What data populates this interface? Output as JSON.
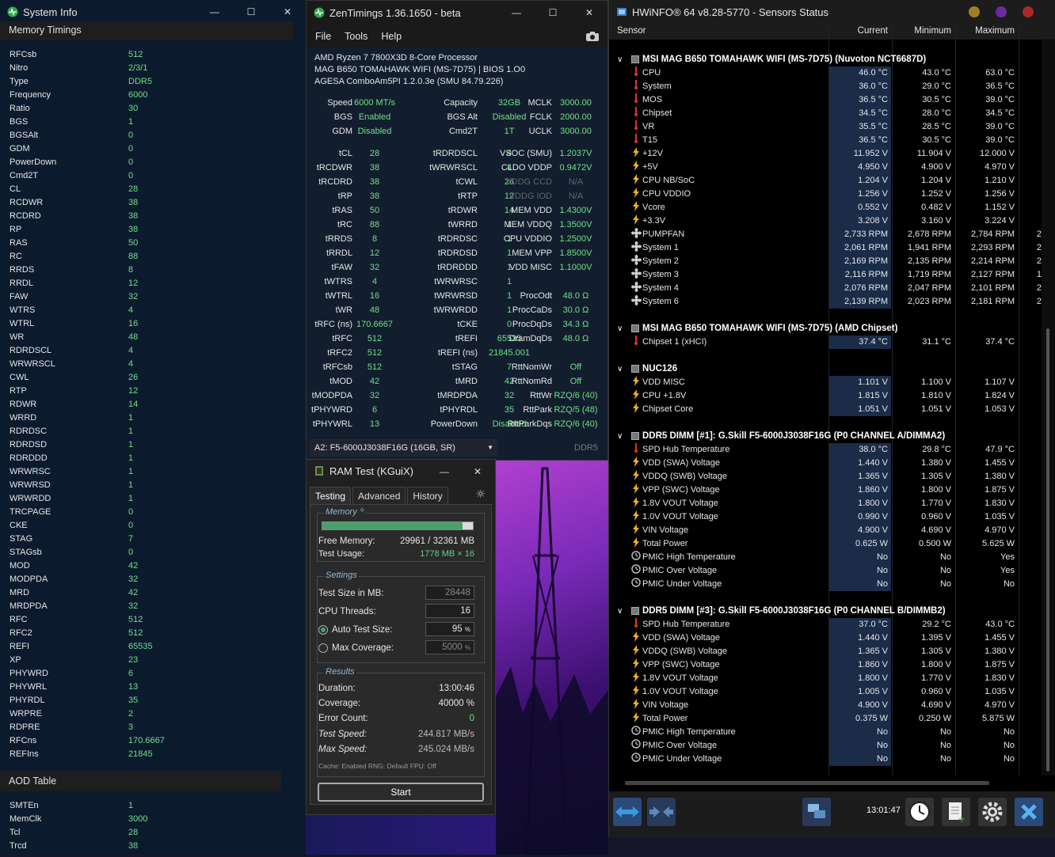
{
  "sysinfo": {
    "title": "System Info",
    "section1": "Memory Timings",
    "rows": [
      [
        "RFCsb",
        "512"
      ],
      [
        "Nitro",
        "2/3/1"
      ],
      [
        "Type",
        "DDR5"
      ],
      [
        "Frequency",
        "6000"
      ],
      [
        "Ratio",
        "30"
      ],
      [
        "BGS",
        "1"
      ],
      [
        "BGSAlt",
        "0"
      ],
      [
        "GDM",
        "0"
      ],
      [
        "PowerDown",
        "0"
      ],
      [
        "Cmd2T",
        "0"
      ],
      [
        "CL",
        "28"
      ],
      [
        "RCDWR",
        "38"
      ],
      [
        "RCDRD",
        "38"
      ],
      [
        "RP",
        "38"
      ],
      [
        "RAS",
        "50"
      ],
      [
        "RC",
        "88"
      ],
      [
        "RRDS",
        "8"
      ],
      [
        "RRDL",
        "12"
      ],
      [
        "FAW",
        "32"
      ],
      [
        "WTRS",
        "4"
      ],
      [
        "WTRL",
        "16"
      ],
      [
        "WR",
        "48"
      ],
      [
        "RDRDSCL",
        "4"
      ],
      [
        "WRWRSCL",
        "4"
      ],
      [
        "CWL",
        "26"
      ],
      [
        "RTP",
        "12"
      ],
      [
        "RDWR",
        "14"
      ],
      [
        "WRRD",
        "1"
      ],
      [
        "RDRDSC",
        "1"
      ],
      [
        "RDRDSD",
        "1"
      ],
      [
        "RDRDDD",
        "1"
      ],
      [
        "WRWRSC",
        "1"
      ],
      [
        "WRWRSD",
        "1"
      ],
      [
        "WRWRDD",
        "1"
      ],
      [
        "TRCPAGE",
        "0"
      ],
      [
        "CKE",
        "0"
      ],
      [
        "STAG",
        "7"
      ],
      [
        "STAGsb",
        "0"
      ],
      [
        "MOD",
        "42"
      ],
      [
        "MODPDA",
        "32"
      ],
      [
        "MRD",
        "42"
      ],
      [
        "MRDPDA",
        "32"
      ],
      [
        "RFC",
        "512"
      ],
      [
        "RFC2",
        "512"
      ],
      [
        "REFI",
        "65535"
      ],
      [
        "XP",
        "23"
      ],
      [
        "PHYWRD",
        "6"
      ],
      [
        "PHYWRL",
        "13"
      ],
      [
        "PHYRDL",
        "35"
      ],
      [
        "WRPRE",
        "2"
      ],
      [
        "RDPRE",
        "3"
      ],
      [
        "RFCns",
        "170.6667"
      ],
      [
        "REFIns",
        "21845"
      ]
    ],
    "section2": "AOD Table",
    "rows2": [
      [
        "SMTEn",
        "1"
      ],
      [
        "MemClk",
        "3000"
      ],
      [
        "Tcl",
        "28"
      ],
      [
        "Trcd",
        "38"
      ]
    ]
  },
  "zen": {
    "title": "ZenTimings 1.36.1650 - beta",
    "menu": [
      "File",
      "Tools",
      "Help"
    ],
    "info": [
      "AMD Ryzen 7 7800X3D 8-Core Processor",
      "MAG B650 TOMAHAWK WIFI (MS-7D75) | BIOS 1.O0",
      "AGESA ComboAm5PI 1.2.0.3e (SMU 84.79.226)"
    ],
    "top": [
      [
        "Speed",
        "6000 MT/s",
        "Capacity",
        "32GB",
        "MCLK",
        "3000.00"
      ],
      [
        "BGS",
        "Enabled",
        "BGS Alt",
        "Disabled",
        "FCLK",
        "2000.00"
      ],
      [
        "GDM",
        "Disabled",
        "Cmd2T",
        "1T",
        "UCLK",
        "3000.00"
      ]
    ],
    "timings": [
      [
        "tCL",
        "28",
        "tRDRDSCL",
        "4",
        "VSOC (SMU)",
        "1.2037V"
      ],
      [
        "tRCDWR",
        "38",
        "tWRWRSCL",
        "4",
        "CLDO VDDP",
        "0.9472V"
      ],
      [
        "tRCDRD",
        "38",
        "tCWL",
        "26",
        "VDDG CCD",
        "N/A"
      ],
      [
        "tRP",
        "38",
        "tRTP",
        "12",
        "VDDG IOD",
        "N/A"
      ],
      [
        "tRAS",
        "50",
        "tRDWR",
        "14",
        "MEM VDD",
        "1.4300V"
      ],
      [
        "tRC",
        "88",
        "tWRRD",
        "1",
        "MEM VDDQ",
        "1.3500V"
      ],
      [
        "tRRDS",
        "8",
        "tRDRDSC",
        "1",
        "CPU VDDIO",
        "1.2500V"
      ],
      [
        "tRRDL",
        "12",
        "tRDRDSD",
        "1",
        "MEM VPP",
        "1.8500V"
      ],
      [
        "tFAW",
        "32",
        "tRDRDDD",
        "1",
        "VDD MISC",
        "1.1000V"
      ],
      [
        "tWTRS",
        "4",
        "tWRWRSC",
        "1",
        "",
        ""
      ],
      [
        "tWTRL",
        "16",
        "tWRWRSD",
        "1",
        "ProcOdt",
        "48.0 Ω"
      ],
      [
        "tWR",
        "48",
        "tWRWRDD",
        "1",
        "ProcCaDs",
        "30.0 Ω"
      ],
      [
        "tRFC (ns)",
        "170.6667",
        "tCKE",
        "0",
        "ProcDqDs",
        "34.3 Ω"
      ],
      [
        "tRFC",
        "512",
        "tREFI",
        "65535",
        "DramDqDs",
        "48.0 Ω"
      ],
      [
        "tRFC2",
        "512",
        "tREFI (ns)",
        "21845.001",
        "",
        ""
      ],
      [
        "tRFCsb",
        "512",
        "tSTAG",
        "7",
        "RttNomWr",
        "Off"
      ],
      [
        "tMOD",
        "42",
        "tMRD",
        "42",
        "RttNomRd",
        "Off"
      ],
      [
        "tMODPDA",
        "32",
        "tMRDPDA",
        "32",
        "RttWr",
        "RZQ/6 (40)"
      ],
      [
        "tPHYWRD",
        "6",
        "tPHYRDL",
        "35",
        "RttPark",
        "RZQ/5 (48)"
      ],
      [
        "tPHYWRL",
        "13",
        "PowerDown",
        "Disabled",
        "RttParkDqs",
        "RZQ/6 (40)"
      ]
    ],
    "module": "A2: F5-6000J3038F16G (16GB, SR)",
    "memtype": "DDR5"
  },
  "ram": {
    "title": "RAM Test (KGuiX)",
    "tabs": [
      "Testing",
      "Advanced",
      "History"
    ],
    "memory_label": "Memory",
    "memory_used_fraction": 0.93,
    "free_memory_label": "Free Memory:",
    "free_memory": "29961 / 32361 MB",
    "test_usage_label": "Test Usage:",
    "test_usage": "1778 MB × 16",
    "settings_label": "Settings",
    "test_size_label": "Test Size in MB:",
    "test_size": "28448",
    "cpu_threads_label": "CPU Threads:",
    "cpu_threads": "16",
    "auto_label": "Auto Test Size:",
    "auto_value": "95",
    "max_label": "Max Coverage:",
    "max_value": "5000",
    "pct": "%",
    "results_label": "Results",
    "duration_label": "Duration:",
    "duration": "13:00:46",
    "coverage_label": "Coverage:",
    "coverage": "40000 %",
    "errors_label": "Error Count:",
    "errors": "0",
    "speed_label": "Test Speed:",
    "speed": "244.817 MB/s",
    "maxspeed_label": "Max Speed:",
    "maxspeed": "245.024 MB/s",
    "footer": "Cache: Enabled  RNG: Default  FPU: Off",
    "start": "Start"
  },
  "hw": {
    "title": "HWiNFO® 64 v8.28-5770 - Sensors Status",
    "cols": [
      "Sensor",
      "Current",
      "Minimum",
      "Maximum"
    ],
    "groups": [
      {
        "name": "MSI MAG B650 TOMAHAWK WIFI (MS-7D75) (Nuvoton NCT6687D)",
        "rows": [
          [
            "t",
            "CPU",
            "46.0 °C",
            "43.0 °C",
            "63.0 °C",
            ""
          ],
          [
            "t",
            "System",
            "36.0 °C",
            "29.0 °C",
            "36.5 °C",
            ""
          ],
          [
            "t",
            "MOS",
            "36.5 °C",
            "30.5 °C",
            "39.0 °C",
            ""
          ],
          [
            "t",
            "Chipset",
            "34.5 °C",
            "28.0 °C",
            "34.5 °C",
            ""
          ],
          [
            "t",
            "VR",
            "35.5 °C",
            "28.5 °C",
            "39.0 °C",
            ""
          ],
          [
            "t",
            "T15",
            "36.5 °C",
            "30.5 °C",
            "39.0 °C",
            ""
          ],
          [
            "v",
            "+12V",
            "11.952 V",
            "11.904 V",
            "12.000 V",
            ""
          ],
          [
            "v",
            "+5V",
            "4.950 V",
            "4.900 V",
            "4.970 V",
            ""
          ],
          [
            "v",
            "CPU NB/SoC",
            "1.204 V",
            "1.204 V",
            "1.210 V",
            ""
          ],
          [
            "v",
            "CPU VDDIO",
            "1.256 V",
            "1.252 V",
            "1.256 V",
            ""
          ],
          [
            "v",
            "Vcore",
            "0.552 V",
            "0.482 V",
            "1.152 V",
            ""
          ],
          [
            "v",
            "+3.3V",
            "3.208 V",
            "3.160 V",
            "3.224 V",
            ""
          ],
          [
            "f",
            "PUMPFAN",
            "2,733 RPM",
            "2,678 RPM",
            "2,784 RPM",
            "2"
          ],
          [
            "f",
            "System 1",
            "2,061 RPM",
            "1,941 RPM",
            "2,293 RPM",
            "2"
          ],
          [
            "f",
            "System 2",
            "2,169 RPM",
            "2,135 RPM",
            "2,214 RPM",
            "2"
          ],
          [
            "f",
            "System 3",
            "2,116 RPM",
            "1,719 RPM",
            "2,127 RPM",
            "1"
          ],
          [
            "f",
            "System 4",
            "2,076 RPM",
            "2,047 RPM",
            "2,101 RPM",
            "2"
          ],
          [
            "f",
            "System 6",
            "2,139 RPM",
            "2,023 RPM",
            "2,181 RPM",
            "2"
          ]
        ]
      },
      {
        "name": "MSI MAG B650 TOMAHAWK WIFI (MS-7D75) (AMD Chipset)",
        "rows": [
          [
            "t",
            "Chipset 1 (xHCI)",
            "37.4 °C",
            "31.1 °C",
            "37.4 °C",
            ""
          ]
        ]
      },
      {
        "name": "NUC126",
        "rows": [
          [
            "v",
            "VDD MISC",
            "1.101 V",
            "1.100 V",
            "1.107 V",
            ""
          ],
          [
            "v",
            "CPU +1.8V",
            "1.815 V",
            "1.810 V",
            "1.824 V",
            ""
          ],
          [
            "v",
            "Chipset Core",
            "1.051 V",
            "1.051 V",
            "1.053 V",
            ""
          ]
        ]
      },
      {
        "name": "DDR5 DIMM [#1]: G.Skill F5-6000J3038F16G (P0 CHANNEL A/DIMMA2)",
        "rows": [
          [
            "t",
            "SPD Hub Temperature",
            "38.0 °C",
            "29.8 °C",
            "47.9 °C",
            ""
          ],
          [
            "v",
            "VDD (SWA) Voltage",
            "1.440 V",
            "1.380 V",
            "1.455 V",
            ""
          ],
          [
            "v",
            "VDDQ (SWB) Voltage",
            "1.365 V",
            "1.305 V",
            "1.380 V",
            ""
          ],
          [
            "v",
            "VPP (SWC) Voltage",
            "1.860 V",
            "1.800 V",
            "1.875 V",
            ""
          ],
          [
            "v",
            "1.8V VOUT Voltage",
            "1.800 V",
            "1.770 V",
            "1.830 V",
            ""
          ],
          [
            "v",
            "1.0V VOUT Voltage",
            "0.990 V",
            "0.960 V",
            "1.035 V",
            ""
          ],
          [
            "v",
            "VIN Voltage",
            "4.900 V",
            "4.690 V",
            "4.970 V",
            ""
          ],
          [
            "v",
            "Total Power",
            "0.625 W",
            "0.500 W",
            "5.625 W",
            ""
          ],
          [
            "c",
            "PMIC High Temperature",
            "No",
            "No",
            "Yes",
            ""
          ],
          [
            "c",
            "PMIC Over Voltage",
            "No",
            "No",
            "Yes",
            ""
          ],
          [
            "c",
            "PMIC Under Voltage",
            "No",
            "No",
            "No",
            ""
          ]
        ]
      },
      {
        "name": "DDR5 DIMM [#3]: G.Skill F5-6000J3038F16G (P0 CHANNEL B/DIMMB2)",
        "rows": [
          [
            "t",
            "SPD Hub Temperature",
            "37.0 °C",
            "29.2 °C",
            "43.0 °C",
            ""
          ],
          [
            "v",
            "VDD (SWA) Voltage",
            "1.440 V",
            "1.395 V",
            "1.455 V",
            ""
          ],
          [
            "v",
            "VDDQ (SWB) Voltage",
            "1.365 V",
            "1.305 V",
            "1.380 V",
            ""
          ],
          [
            "v",
            "VPP (SWC) Voltage",
            "1.860 V",
            "1.800 V",
            "1.875 V",
            ""
          ],
          [
            "v",
            "1.8V VOUT Voltage",
            "1.800 V",
            "1.770 V",
            "1.830 V",
            ""
          ],
          [
            "v",
            "1.0V VOUT Voltage",
            "1.005 V",
            "0.960 V",
            "1.035 V",
            ""
          ],
          [
            "v",
            "VIN Voltage",
            "4.900 V",
            "4.690 V",
            "4.970 V",
            ""
          ],
          [
            "v",
            "Total Power",
            "0.375 W",
            "0.250 W",
            "5.875 W",
            ""
          ],
          [
            "c",
            "PMIC High Temperature",
            "No",
            "No",
            "No",
            ""
          ],
          [
            "c",
            "PMIC Over Voltage",
            "No",
            "No",
            "No",
            ""
          ],
          [
            "c",
            "PMIC Under Voltage",
            "No",
            "No",
            "No",
            ""
          ]
        ]
      }
    ],
    "clock": "13:01:47"
  }
}
